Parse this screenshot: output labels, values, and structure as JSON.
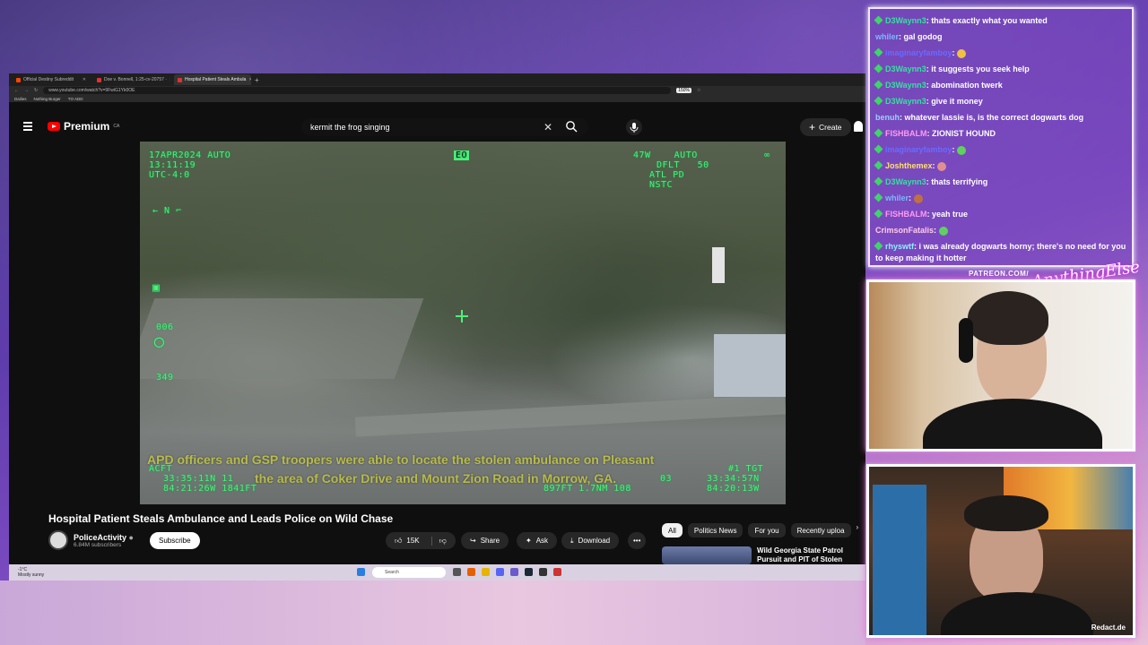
{
  "browser": {
    "tabs": [
      {
        "label": "Official Destiny Subreddit",
        "active": false
      },
      {
        "label": "Doe v. Bonnell, 1:25-cv-20757 ·",
        "active": false
      },
      {
        "label": "Hospital Patient Steals Ambula",
        "active": true
      }
    ],
    "url": "www.youtube.com/watch?v=9FwiG1Yk0OE",
    "zoom": "150%",
    "bookmarks": [
      "Dailies",
      "Nothing Burger",
      "TO ADD"
    ]
  },
  "youtube": {
    "logo": "Premium",
    "logo_region": "CA",
    "search_value": "kermit the frog singing",
    "create_label": "Create",
    "video": {
      "hud": {
        "date": "17APR2024",
        "mode": "AUTO",
        "time": "13:11:19",
        "utc": "UTC-4:0",
        "eo": "EO",
        "right1": "47W",
        "right2": "AUTO",
        "right3": "DFLT",
        "right4": "50",
        "right5": "ATL PD",
        "right6": "NSTC",
        "north": "N",
        "n006": "006",
        "n349": "349",
        "acft": "ACFT",
        "lat1": "33:35:11N",
        "lon1": "84:21:26W",
        "alt1": "11",
        "ft": "1841FT",
        "tgt": "#1 TGT",
        "lat2": "33:34:57N",
        "lon2": "84:20:13W",
        "mid": "897FT",
        "mid2": "1.7NM",
        "mid3": "108",
        "mid4": "03"
      },
      "caption_line1": "APD officers and GSP troopers were able to locate the stolen ambulance on Pleasant",
      "caption_line2": "the area of Coker Drive and Mount Zion Road in Morrow, GA."
    },
    "title": "Hospital Patient Steals Ambulance and Leads Police on Wild Chase",
    "channel": {
      "name": "PoliceActivity",
      "subs": "6.84M subscribers"
    },
    "subscribe": "Subscribe",
    "likes": "15K",
    "share": "Share",
    "ask": "Ask",
    "download": "Download",
    "chips": [
      "All",
      "Politics News",
      "For you",
      "Recently uploa"
    ],
    "rec_title": "Wild Georgia State Patrol Pursuit and PIT of Stolen"
  },
  "taskbar": {
    "weather_temp": "-1°C",
    "weather_desc": "Mostly sunny",
    "search": "Search"
  },
  "chat": [
    {
      "user": "D3Waynn3",
      "color": "#36e0a0",
      "badge": true,
      "text": "thats exactly what you wanted"
    },
    {
      "user": "whiler",
      "color": "#7ab8ff",
      "badge": false,
      "text": "gal godog"
    },
    {
      "user": "imaginaryfamboy",
      "color": "#6a6aff",
      "badge": true,
      "text": ""
    },
    {
      "user": "D3Waynn3",
      "color": "#36e0a0",
      "badge": true,
      "text": "it suggests you seek help"
    },
    {
      "user": "D3Waynn3",
      "color": "#36e0a0",
      "badge": true,
      "text": "abomination twerk"
    },
    {
      "user": "D3Waynn3",
      "color": "#36e0a0",
      "badge": true,
      "text": "give it money"
    },
    {
      "user": "benuh",
      "color": "#9ad0ff",
      "badge": false,
      "text": "whatever lassie is, is the correct dogwarts dog"
    },
    {
      "user": "FISHBALM",
      "color": "#ff9af0",
      "badge": true,
      "text": "ZIONIST HOUND"
    },
    {
      "user": "imaginaryfamboy",
      "color": "#6a6aff",
      "badge": true,
      "text": ""
    },
    {
      "user": "Joshthemex",
      "color": "#ffe06a",
      "badge": true,
      "text": ""
    },
    {
      "user": "D3Waynn3",
      "color": "#36e0a0",
      "badge": true,
      "text": "thats terrifying"
    },
    {
      "user": "whiler",
      "color": "#7ab8ff",
      "badge": true,
      "text": ""
    },
    {
      "user": "FISHBALM",
      "color": "#ff9af0",
      "badge": true,
      "text": "yeah true"
    },
    {
      "user": "CrimsonFatalis",
      "color": "#ffcbe8",
      "badge": false,
      "text": ""
    },
    {
      "user": "rhyswtf",
      "color": "#8cf0ff",
      "badge": true,
      "text": "i was already dogwarts horny; there's no need for you to keep making it hotter"
    }
  ],
  "overlay": {
    "patreon": "PATREON.COM/",
    "signature": "AnythingElse",
    "watermark": "Redact.de"
  }
}
